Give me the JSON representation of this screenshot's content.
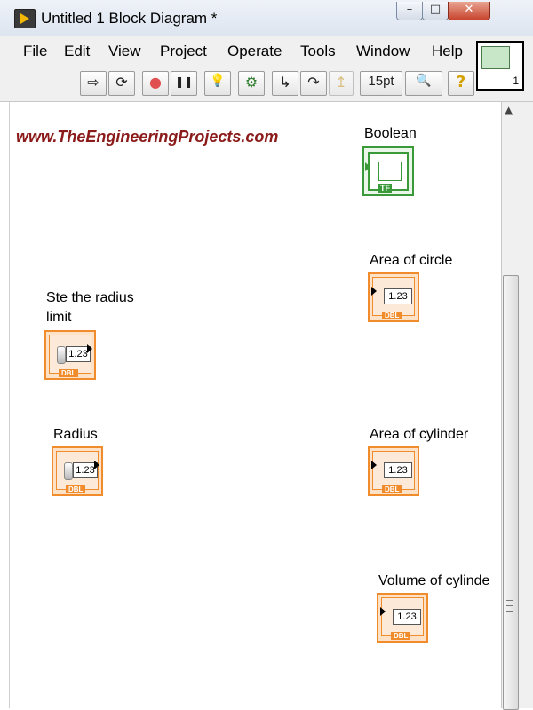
{
  "window": {
    "title": "Untitled 1 Block Diagram *",
    "controls": {
      "minimize": "–",
      "maximize": "□",
      "close": "✕"
    }
  },
  "menubar": {
    "items": [
      "File",
      "Edit",
      "View",
      "Project",
      "Operate",
      "Tools",
      "Window",
      "Help"
    ]
  },
  "toolbar": {
    "font_size": "15pt",
    "buttons": [
      {
        "icon": "run-arrow-icon",
        "glyph": "⇨"
      },
      {
        "icon": "run-continuously-icon",
        "glyph": "⟳"
      },
      {
        "icon": "abort-icon",
        "glyph": "●"
      },
      {
        "icon": "pause-icon",
        "glyph": "❚❚"
      },
      {
        "icon": "highlight-execution-icon",
        "glyph": "💡"
      },
      {
        "icon": "retain-wire-values-icon",
        "glyph": "⚙"
      },
      {
        "icon": "step-into-icon",
        "glyph": "↳"
      },
      {
        "icon": "step-over-icon",
        "glyph": "↷"
      },
      {
        "icon": "step-out-icon",
        "glyph": "↥"
      },
      {
        "icon": "search-icon",
        "glyph": "🔍"
      },
      {
        "icon": "help-icon",
        "glyph": "?"
      }
    ]
  },
  "vi_icon": {
    "number": "1"
  },
  "diagram": {
    "watermark": "www.TheEngineeringProjects.com",
    "boolean": {
      "label": "Boolean",
      "tf": "TF"
    },
    "controls": [
      {
        "label_line1": "Ste the radius",
        "label_line2": "limit",
        "value": "1.23",
        "type": "DBL"
      },
      {
        "label_line1": "Radius",
        "value": "1.23",
        "type": "DBL"
      }
    ],
    "indicators": [
      {
        "label": "Area of circle",
        "value": "1.23",
        "type": "DBL"
      },
      {
        "label": "Area of cylinder",
        "value": "1.23",
        "type": "DBL"
      },
      {
        "label": "Volume of cylinde",
        "value": "1.23",
        "type": "DBL"
      }
    ]
  },
  "colors": {
    "numeric_orange": "#f08c2c",
    "boolean_green": "#3a9a3a",
    "watermark_red": "#8b1a1a"
  }
}
